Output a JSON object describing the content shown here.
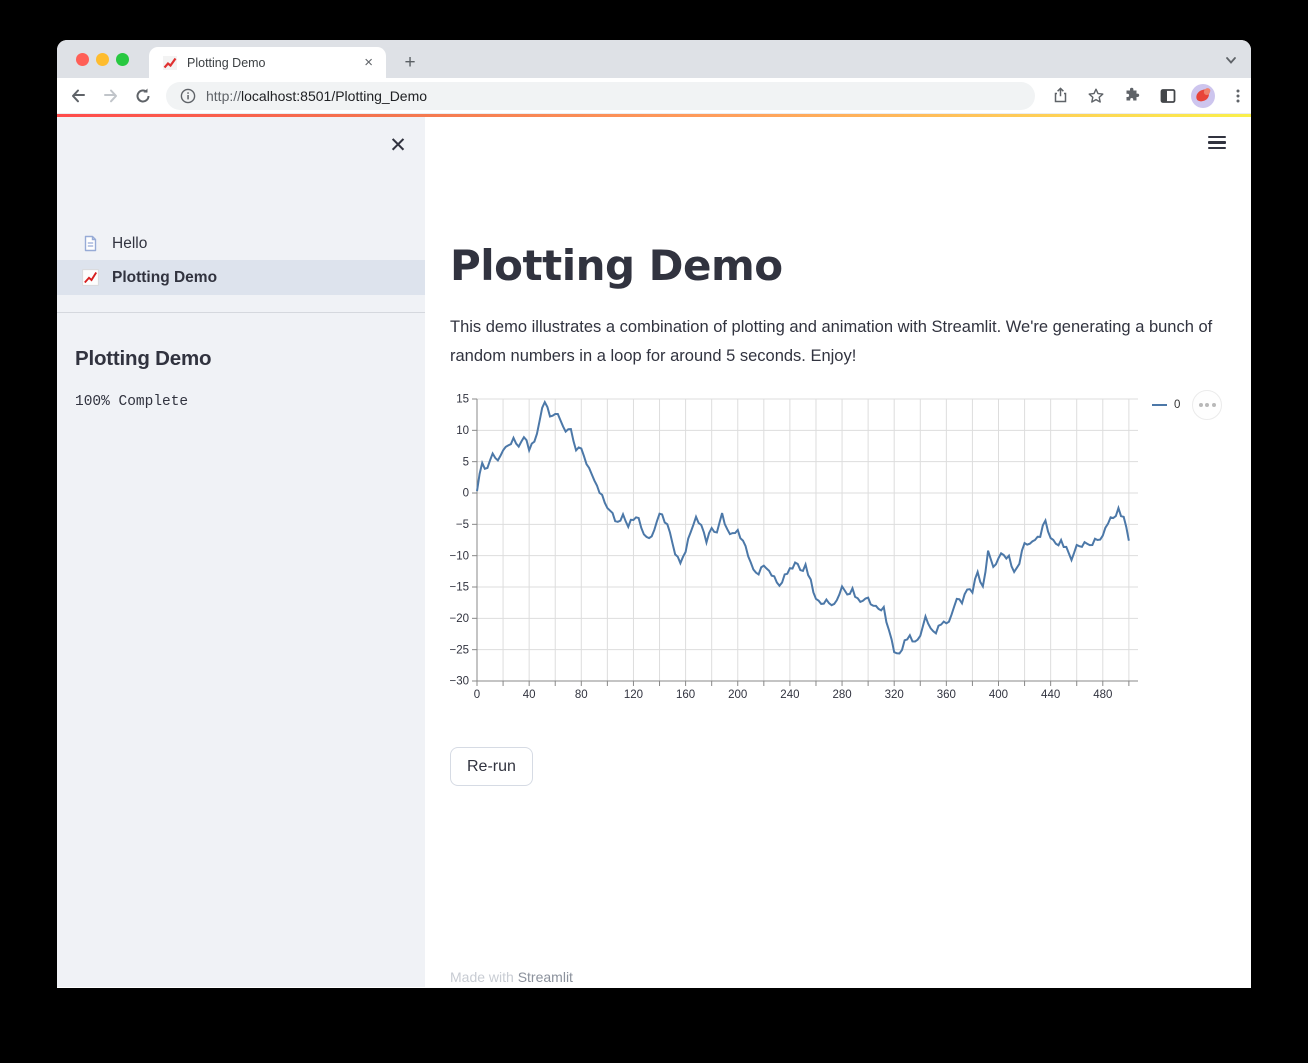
{
  "browser": {
    "tab_title": "Plotting Demo",
    "url_scheme": "http://",
    "url_rest": "localhost:8501/Plotting_Demo"
  },
  "sidebar": {
    "nav": [
      {
        "label": "Hello",
        "icon": "document-page-icon",
        "selected": false
      },
      {
        "label": "Plotting Demo",
        "icon": "chart-increasing-icon",
        "selected": true
      }
    ],
    "section_title": "Plotting Demo",
    "progress_text": "100% Complete"
  },
  "main": {
    "title": "Plotting Demo",
    "description": "This demo illustrates a combination of plotting and animation with Streamlit. We're generating a bunch of random numbers in a loop for around 5 seconds. Enjoy!",
    "rerun_label": "Re-run",
    "footer_made_with": "Made with ",
    "footer_brand": "Streamlit"
  },
  "colors": {
    "chart_line": "#4c78a8",
    "decoration_gradient": [
      "#ff4b4b",
      "#faf04b"
    ],
    "sidebar_bg": "#f0f2f6",
    "nav_selected_bg": "#dde3ed",
    "text": "#31333f"
  },
  "chart_data": {
    "type": "line",
    "title": "",
    "xlabel": "",
    "ylabel": "",
    "xlim": [
      0,
      507
    ],
    "ylim": [
      -30,
      15
    ],
    "x_tick_labels": [
      0,
      40,
      80,
      120,
      160,
      200,
      240,
      280,
      320,
      360,
      400,
      440,
      480
    ],
    "x_grid_step": 20,
    "y_tick_step": 5,
    "grid": true,
    "legend_position": "right",
    "x_start": 0,
    "x_step": 4,
    "series": [
      {
        "name": "0",
        "color": "#4c78a8",
        "values": [
          0.3,
          4.8,
          4.0,
          6.3,
          5.2,
          6.8,
          7.6,
          8.8,
          7.4,
          8.9,
          6.8,
          8.2,
          11.5,
          14.5,
          12.2,
          12.6,
          11.6,
          9.8,
          10.2,
          6.8,
          7.1,
          4.6,
          3.0,
          1.2,
          -0.3,
          -2.4,
          -3.2,
          -4.6,
          -3.4,
          -5.4,
          -4.3,
          -4.0,
          -6.6,
          -7.2,
          -5.9,
          -3.3,
          -4.7,
          -6.3,
          -9.8,
          -11.2,
          -9.4,
          -6.2,
          -3.8,
          -5.1,
          -7.9,
          -5.6,
          -6.3,
          -3.2,
          -5.8,
          -6.4,
          -5.9,
          -7.6,
          -10.1,
          -12.2,
          -13.0,
          -11.6,
          -12.4,
          -13.3,
          -14.8,
          -13.0,
          -12.0,
          -11.1,
          -12.3,
          -11.4,
          -13.8,
          -16.9,
          -17.7,
          -17.0,
          -17.9,
          -17.1,
          -14.9,
          -16.2,
          -15.2,
          -16.8,
          -17.2,
          -16.7,
          -18.0,
          -18.5,
          -18.2,
          -21.9,
          -25.4,
          -25.6,
          -23.5,
          -22.7,
          -23.7,
          -22.8,
          -19.7,
          -21.6,
          -22.4,
          -21.0,
          -20.8,
          -19.4,
          -16.9,
          -17.6,
          -15.4,
          -15.9,
          -12.6,
          -14.9,
          -9.2,
          -11.8,
          -10.4,
          -9.9,
          -10.0,
          -12.6,
          -11.3,
          -8.0,
          -8.1,
          -7.5,
          -7.0,
          -4.4,
          -7.2,
          -8.1,
          -7.5,
          -8.6,
          -10.7,
          -8.3,
          -8.6,
          -8.1,
          -8.3,
          -7.5,
          -6.8,
          -4.9,
          -4.0,
          -2.4,
          -3.8,
          -7.6
        ]
      }
    ]
  }
}
